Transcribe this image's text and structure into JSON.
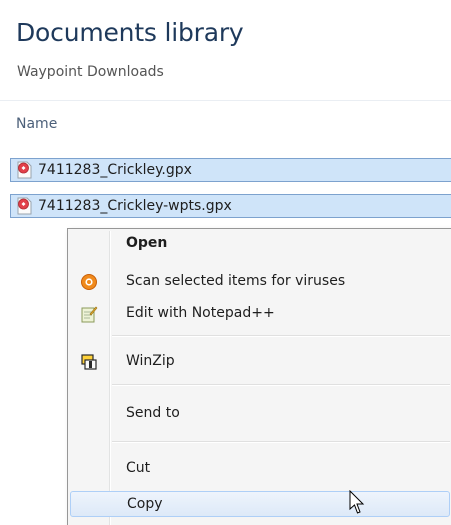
{
  "library": {
    "title": "Documents library",
    "subtitle": "Waypoint Downloads"
  },
  "columns": {
    "name_header": "Name"
  },
  "files": [
    {
      "name": "7411283_Crickley.gpx",
      "icon": "gpx-file-icon",
      "selected": true
    },
    {
      "name": "7411283_Crickley-wpts.gpx",
      "icon": "gpx-file-icon",
      "selected": true
    }
  ],
  "context_menu": {
    "open": "Open",
    "scan": "Scan selected items for viruses",
    "notepad": "Edit with Notepad++",
    "winzip": "WinZip",
    "send_to": "Send to",
    "cut": "Cut",
    "copy": "Copy"
  },
  "colors": {
    "title": "#1e395b",
    "selection_bg": "#cfe4f9",
    "selection_border": "#7da2ce",
    "menu_bg": "#f5f5f5"
  }
}
